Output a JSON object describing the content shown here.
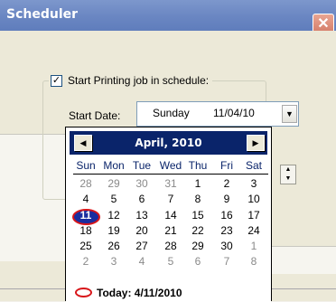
{
  "window": {
    "title": "Scheduler",
    "close_glyph": "✕"
  },
  "group": {
    "checkbox_label": "Start Printing job in schedule:",
    "checked": true,
    "check_glyph": "✓"
  },
  "start_date": {
    "label": "Start Date:",
    "day": "Sunday",
    "date": "11/04/10"
  },
  "calendar": {
    "month_label": "April, 2010",
    "prev_glyph": "◀",
    "next_glyph": "▶",
    "weekdays": [
      "Sun",
      "Mon",
      "Tue",
      "Wed",
      "Thu",
      "Fri",
      "Sat"
    ],
    "weeks": [
      [
        "28",
        "29",
        "30",
        "31",
        "1",
        "2",
        "3"
      ],
      [
        "4",
        "5",
        "6",
        "7",
        "8",
        "9",
        "10"
      ],
      [
        "11",
        "12",
        "13",
        "14",
        "15",
        "16",
        "17"
      ],
      [
        "18",
        "19",
        "20",
        "21",
        "22",
        "23",
        "24"
      ],
      [
        "25",
        "26",
        "27",
        "28",
        "29",
        "30",
        "1"
      ],
      [
        "2",
        "3",
        "4",
        "5",
        "6",
        "7",
        "8"
      ]
    ],
    "muted": [
      [
        true,
        true,
        true,
        true,
        false,
        false,
        false
      ],
      [
        false,
        false,
        false,
        false,
        false,
        false,
        false
      ],
      [
        false,
        false,
        false,
        false,
        false,
        false,
        false
      ],
      [
        false,
        false,
        false,
        false,
        false,
        false,
        false
      ],
      [
        false,
        false,
        false,
        false,
        false,
        false,
        true
      ],
      [
        true,
        true,
        true,
        true,
        true,
        true,
        true
      ]
    ],
    "selected_day": "11",
    "today_label": "Today: 4/11/2010"
  },
  "partial_label": "S",
  "colors": {
    "title_bar": "#6a86c2",
    "calendar_header": "#0a246a",
    "weekday_text": "#0a246a",
    "today_circle": "#d8161a",
    "selected_fill": "#1a2d9f"
  }
}
